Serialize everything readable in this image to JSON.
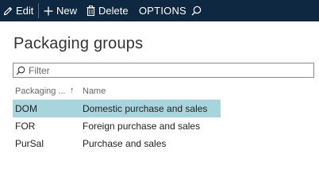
{
  "toolbar": {
    "edit_label": "Edit",
    "new_label": "New",
    "delete_label": "Delete",
    "options_label": "OPTIONS",
    "background": "#0e2841"
  },
  "page": {
    "title": "Packaging groups"
  },
  "filter": {
    "placeholder": "Filter",
    "value": ""
  },
  "grid": {
    "columns": [
      {
        "label": "Packaging ...",
        "sort": "ascending"
      },
      {
        "label": "Name"
      }
    ],
    "rows": [
      {
        "code": "DOM",
        "name": "Domestic purchase and sales",
        "selected": true
      },
      {
        "code": "FOR",
        "name": "Foreign purchase and sales",
        "selected": false
      },
      {
        "code": "PurSal",
        "name": "Purchase and sales",
        "selected": false
      }
    ],
    "selected_color": "#a8d4de"
  }
}
